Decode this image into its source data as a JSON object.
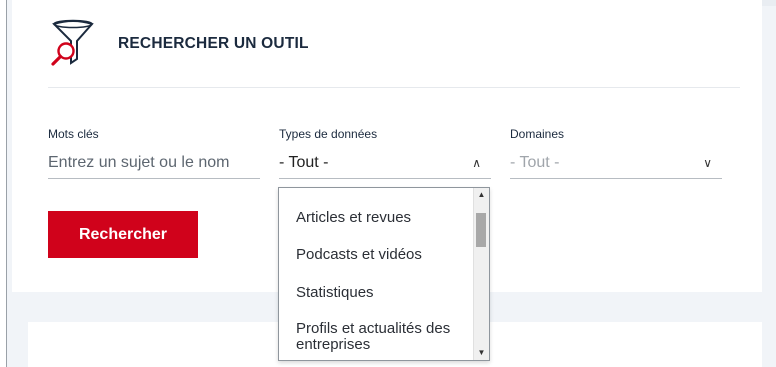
{
  "header": {
    "title": "RECHERCHER UN OUTIL",
    "icon": "funnel-search-icon"
  },
  "fields": {
    "keywords": {
      "label": "Mots clés",
      "placeholder": "Entrez un sujet ou le nom"
    },
    "data_types": {
      "label": "Types de données",
      "value": "- Tout -",
      "expanded": true
    },
    "domains": {
      "label": "Domaines",
      "value": "- Tout -"
    }
  },
  "search_button": {
    "label": "Rechercher"
  },
  "dropdown": {
    "options": [
      "Articles et revues",
      "Podcasts et vidéos",
      "Statistiques",
      "Profils et actualités des entreprises"
    ]
  },
  "colors": {
    "accent": "#d0021b",
    "title": "#1b2a3e"
  }
}
